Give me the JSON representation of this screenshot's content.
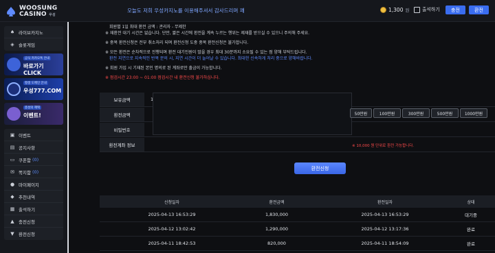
{
  "brand": {
    "line1": "WOOSUNG",
    "line2": "CASINO",
    "tag": "우성"
  },
  "header": {
    "marquee": "오늘도 저희 우성카지노를 이용해주셔서 감사드리며 꽤",
    "balance": "1,300",
    "balance_unit": "원",
    "attendance": "출석하기",
    "charge_btn": "충전",
    "exchange_btn": "환전"
  },
  "sidebar": {
    "top_items": [
      {
        "label": "라이브카지노",
        "icon": "spade-icon"
      },
      {
        "label": "슬롯게임",
        "icon": "slot-icon"
      }
    ],
    "banners": [
      {
        "sub": "공식 카카오톡 안내",
        "main": "바로가기 CLICK"
      },
      {
        "sub": "평생 도메인 안내",
        "main": "우성777.COM"
      },
      {
        "sub": "충성의 혜택",
        "main": "이벤트!"
      }
    ],
    "menu": [
      {
        "label": "이벤트",
        "count": ""
      },
      {
        "label": "공지사항",
        "count": ""
      },
      {
        "label": "쿠폰함",
        "count": "(0)"
      },
      {
        "label": "쪽지함",
        "count": "(0)"
      },
      {
        "label": "마이페이지",
        "count": ""
      },
      {
        "label": "추천내역",
        "count": ""
      },
      {
        "label": "출석하기",
        "count": ""
      },
      {
        "label": "충전신청",
        "count": ""
      },
      {
        "label": "환전신청",
        "count": ""
      }
    ]
  },
  "notice": {
    "line0": "회원별 1일 최대 환전 금액 : 관리자 - 무제한",
    "line1": "※ 재환전 대기 시간은 없습니다. 단만, 짧은 시간에 환전을 계속 누르는 행위는 제재를 받으실 수 있으니 주의해 주세요.",
    "line2": "※ 중복 환전신청은 전부 취소처리 되며 환전신청 도중 중복 환전신청은 불가합니다.",
    "line3": "※ 모든 환전은 순차적으로 진행되며 환전 대기인원이 많을 경우 최대 30분까지 소요될 수 있는 점 양해 부탁드립니다.",
    "line4": "환전 지연으로 지속적인 반복 문의 시, 지연 시간이 더 늘어날 수 있습니다. 최대한 신속하게 처리 중으로 양해바랍니다.",
    "line5": "※ 회원 가입 시 기재된 본인 명의로 된 계좌로만 출금이 가능합니다.",
    "line6": "※ 점검시간 23:00 ~ 01:00 점검시간 내 환전신청 불가하십니다."
  },
  "form": {
    "labels": [
      "보유금액",
      "환전금액",
      "비밀번호",
      "환전계좌 정보"
    ],
    "balance_value": "1",
    "amount_buttons": [
      "50만원",
      "100만원",
      "300만원",
      "500만원",
      "1000만원"
    ],
    "hint": "※ 10,000 원 단위로 환전 가능합니다."
  },
  "submit_label": "환전신청",
  "history": {
    "headers": [
      "신청일자",
      "환전금액",
      "환전일자",
      "상태"
    ],
    "rows": [
      [
        "2025-04-13 16:53:29",
        "1,830,000",
        "2025-04-13 16:53:29",
        "대기중"
      ],
      [
        "2025-04-12 13:02:42",
        "1,290,000",
        "2025-04-12 13:17:36",
        "완료"
      ],
      [
        "2025-04-11 18:42:53",
        "820,000",
        "2025-04-11 18:54:09",
        "완료"
      ]
    ]
  },
  "colors": {
    "accent": "#3a6df0",
    "danger": "#ff4b4b",
    "info": "#5f8bff"
  }
}
